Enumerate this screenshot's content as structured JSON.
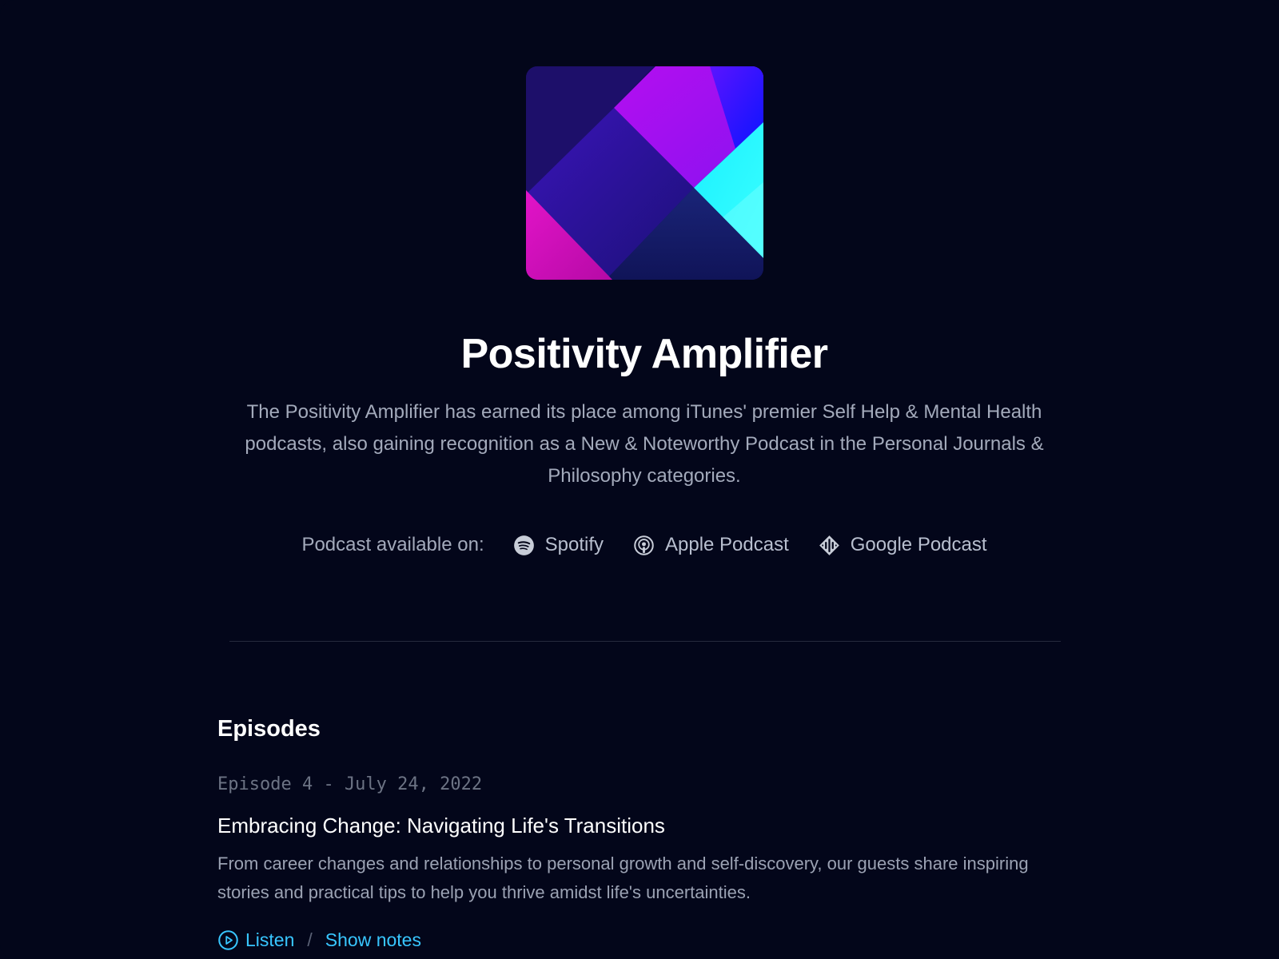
{
  "podcast": {
    "title": "Positivity Amplifier",
    "description": "The Positivity Amplifier has earned its place among iTunes' premier Self Help & Mental Health podcasts, also gaining recognition as a New & Noteworthy Podcast in the Personal Journals & Philosophy categories.",
    "cover_art": {
      "icon": "abstract-geometric-cover-art",
      "colors": [
        "#1a0e6e",
        "#c313f5",
        "#1410ff",
        "#18f4ff",
        "#e011b8",
        "#141a6e"
      ]
    }
  },
  "platforms": {
    "lead_text": "Podcast available on:",
    "items": [
      {
        "label": "Spotify",
        "icon": "spotify-icon"
      },
      {
        "label": "Apple Podcast",
        "icon": "apple-podcast-icon"
      },
      {
        "label": "Google Podcast",
        "icon": "google-podcast-icon"
      }
    ]
  },
  "episodes": {
    "heading": "Episodes",
    "items": [
      {
        "meta": "Episode 4 - July 24, 2022",
        "title": "Embracing Change: Navigating Life's Transitions",
        "description": "From career changes and relationships to personal growth and self-discovery, our guests share inspiring stories and practical tips to help you thrive amidst life's uncertainties.",
        "listen_label": "Listen",
        "separator": "/",
        "notes_label": "Show notes"
      }
    ]
  },
  "colors": {
    "background": "#03061a",
    "accent": "#38c6ff",
    "text_primary": "#ffffff",
    "text_secondary": "#a3aabb"
  }
}
